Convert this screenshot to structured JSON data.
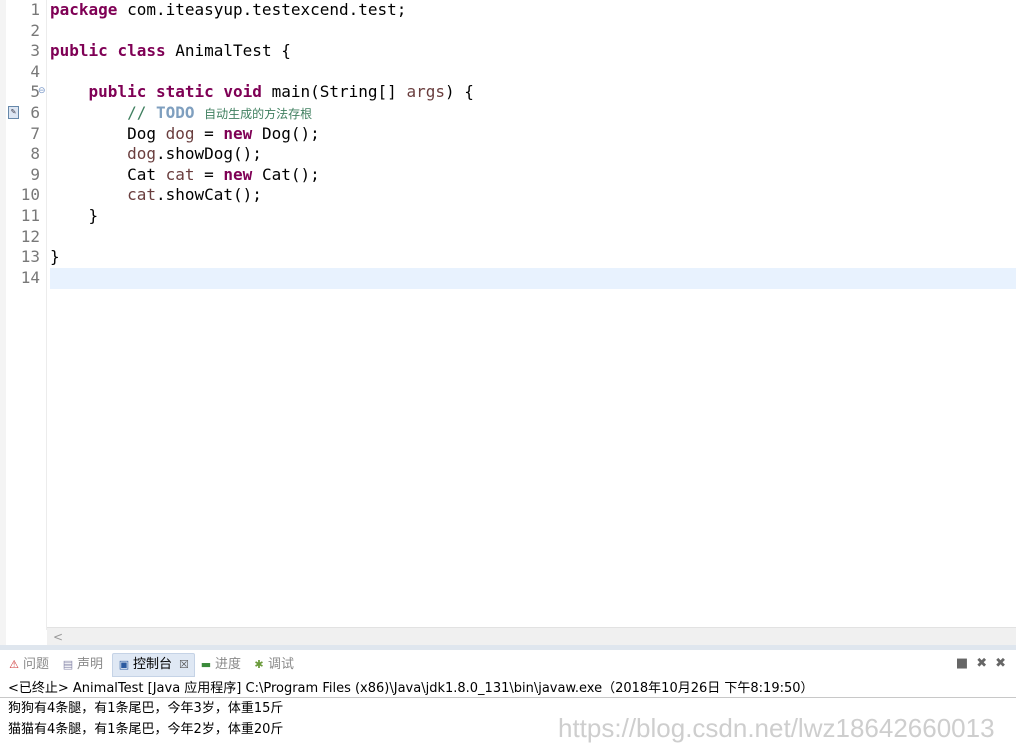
{
  "editor": {
    "lines": [
      {
        "num": "1",
        "tokens": [
          {
            "t": "package",
            "c": "kw"
          },
          {
            "t": " com.iteasyup.testexcend.test;",
            "c": ""
          }
        ]
      },
      {
        "num": "2",
        "tokens": []
      },
      {
        "num": "3",
        "tokens": [
          {
            "t": "public",
            "c": "kw"
          },
          {
            "t": " ",
            "c": ""
          },
          {
            "t": "class",
            "c": "kw"
          },
          {
            "t": " AnimalTest {",
            "c": ""
          }
        ]
      },
      {
        "num": "4",
        "tokens": []
      },
      {
        "num": "5",
        "tokens": [
          {
            "t": "    ",
            "c": ""
          },
          {
            "t": "public",
            "c": "kw"
          },
          {
            "t": " ",
            "c": ""
          },
          {
            "t": "static",
            "c": "kw"
          },
          {
            "t": " ",
            "c": ""
          },
          {
            "t": "void",
            "c": "kw"
          },
          {
            "t": " main(String[] ",
            "c": ""
          },
          {
            "t": "args",
            "c": "var"
          },
          {
            "t": ") {",
            "c": ""
          }
        ]
      },
      {
        "num": "6",
        "tokens": [
          {
            "t": "        // ",
            "c": "cm"
          },
          {
            "t": "TODO",
            "c": "todo"
          },
          {
            "t": " ",
            "c": "cm"
          },
          {
            "t": "自动生成的方法存根",
            "c": "cjk"
          }
        ]
      },
      {
        "num": "7",
        "tokens": [
          {
            "t": "        Dog ",
            "c": ""
          },
          {
            "t": "dog",
            "c": "var"
          },
          {
            "t": " = ",
            "c": ""
          },
          {
            "t": "new",
            "c": "kw"
          },
          {
            "t": " Dog();",
            "c": ""
          }
        ]
      },
      {
        "num": "8",
        "tokens": [
          {
            "t": "        ",
            "c": ""
          },
          {
            "t": "dog",
            "c": "var"
          },
          {
            "t": ".showDog();",
            "c": ""
          }
        ]
      },
      {
        "num": "9",
        "tokens": [
          {
            "t": "        Cat ",
            "c": ""
          },
          {
            "t": "cat",
            "c": "var"
          },
          {
            "t": " = ",
            "c": ""
          },
          {
            "t": "new",
            "c": "kw"
          },
          {
            "t": " Cat();",
            "c": ""
          }
        ]
      },
      {
        "num": "10",
        "tokens": [
          {
            "t": "        ",
            "c": ""
          },
          {
            "t": "cat",
            "c": "var"
          },
          {
            "t": ".showCat();",
            "c": ""
          }
        ]
      },
      {
        "num": "11",
        "tokens": [
          {
            "t": "    }",
            "c": ""
          }
        ]
      },
      {
        "num": "12",
        "tokens": []
      },
      {
        "num": "13",
        "tokens": [
          {
            "t": "}",
            "c": ""
          }
        ]
      },
      {
        "num": "14",
        "tokens": []
      }
    ]
  },
  "panel": {
    "tabs": [
      {
        "label": "问题",
        "icon": "problems-icon"
      },
      {
        "label": "声明",
        "icon": "declaration-icon"
      },
      {
        "label": "控制台",
        "icon": "console-icon"
      },
      {
        "label": "进度",
        "icon": "progress-icon"
      },
      {
        "label": "调试",
        "icon": "debug-icon"
      }
    ],
    "close_glyph": "☒"
  },
  "console": {
    "header": "<已终止> AnimalTest [Java 应用程序] C:\\Program Files (x86)\\Java\\jdk1.8.0_131\\bin\\javaw.exe（2018年10月26日 下午8:19:50）",
    "output": [
      "狗狗有4条腿，有1条尾巴，今年3岁，体重15斤",
      "猫猫有4条腿，有1条尾巴，今年2岁，体重20斤"
    ]
  },
  "watermark": "https://blog.csdn.net/lwz18642660013"
}
